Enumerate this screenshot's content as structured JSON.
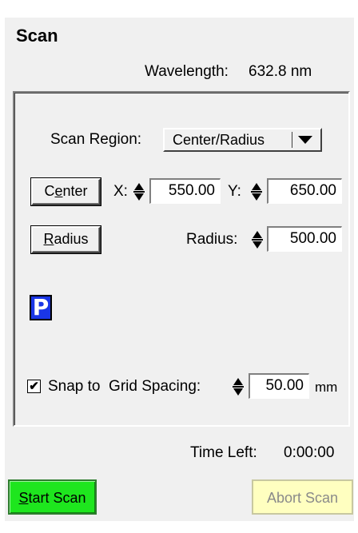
{
  "panel": {
    "title": "Scan",
    "wavelength_label": "Wavelength:",
    "wavelength_value": "632.8 nm"
  },
  "scan_region": {
    "label": "Scan Region:",
    "selected": "Center/Radius"
  },
  "center": {
    "button_label_pre": "C",
    "button_label_u": "e",
    "button_label_post": "nter",
    "x_label": "X:",
    "x_value": "550.00",
    "y_label": "Y:",
    "y_value": "650.00"
  },
  "radius": {
    "button_label_u": "R",
    "button_label_post": "adius",
    "label": "Radius:",
    "value": "500.00"
  },
  "p_icon": {
    "glyph": "P",
    "color": "#1a36e6"
  },
  "snap": {
    "checked": true,
    "check_glyph": "✔",
    "label": "Snap to  Grid Spacing:",
    "value": "50.00",
    "unit": "mm"
  },
  "time_left": {
    "label": "Time Left:",
    "value": "0:00:00"
  },
  "buttons": {
    "start_u": "S",
    "start_post": "tart Scan",
    "abort": "Abort Scan",
    "start_color": "#1ee61e",
    "abort_color": "#ffffc0"
  }
}
